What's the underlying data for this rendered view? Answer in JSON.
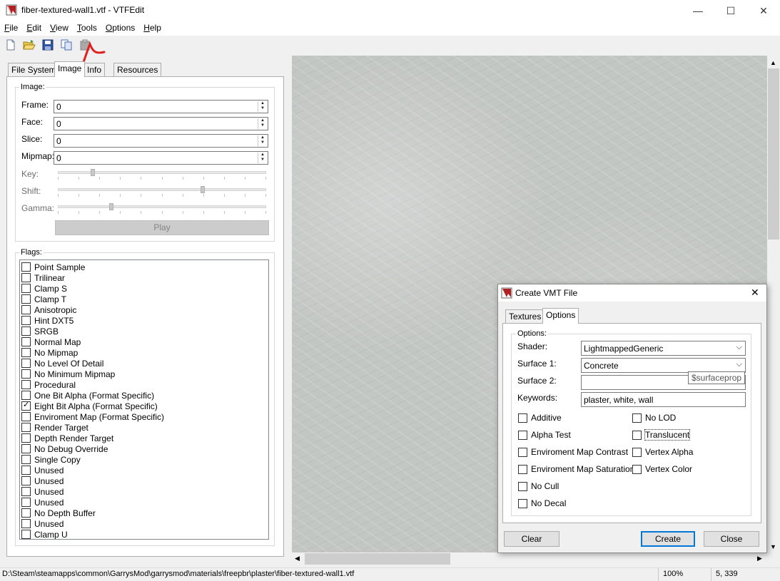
{
  "window": {
    "title": "fiber-textured-wall1.vtf - VTFEdit",
    "min_glyph": "—",
    "max_glyph": "☐",
    "close_glyph": "✕"
  },
  "menu": [
    {
      "label": "File",
      "accel": "F",
      "rest": "ile"
    },
    {
      "label": "Edit",
      "accel": "E",
      "rest": "dit"
    },
    {
      "label": "View",
      "accel": "V",
      "rest": "iew"
    },
    {
      "label": "Tools",
      "accel": "T",
      "rest": "ools"
    },
    {
      "label": "Options",
      "accel": "O",
      "rest": "ptions"
    },
    {
      "label": "Help",
      "accel": "H",
      "rest": "elp"
    }
  ],
  "toolbar": {
    "icons": [
      "new-icon",
      "open-icon",
      "save-icon",
      "copy-icon",
      "paste-icon"
    ]
  },
  "tabs": [
    "File System",
    "Image",
    "Info",
    "Resources"
  ],
  "active_tab": "Image",
  "image_group": {
    "label": "Image:",
    "frame_label": "Frame:",
    "frame_value": "0",
    "face_label": "Face:",
    "face_value": "0",
    "slice_label": "Slice:",
    "slice_value": "0",
    "mipmap_label": "Mipmap:",
    "mipmap_value": "0",
    "key_label": "Key:",
    "key_level": 0.16,
    "shift_label": "Shift:",
    "shift_level": 0.7,
    "gamma_label": "Gamma:",
    "gamma_level": 0.25,
    "play_label": "Play"
  },
  "flags_group": {
    "label": "Flags:",
    "items": [
      {
        "label": "Point Sample",
        "checked": false
      },
      {
        "label": "Trilinear",
        "checked": false
      },
      {
        "label": "Clamp S",
        "checked": false
      },
      {
        "label": "Clamp T",
        "checked": false
      },
      {
        "label": "Anisotropic",
        "checked": false
      },
      {
        "label": "Hint DXT5",
        "checked": false
      },
      {
        "label": "SRGB",
        "checked": false
      },
      {
        "label": "Normal Map",
        "checked": false
      },
      {
        "label": "No Mipmap",
        "checked": false
      },
      {
        "label": "No Level Of Detail",
        "checked": false
      },
      {
        "label": "No Minimum Mipmap",
        "checked": false
      },
      {
        "label": "Procedural",
        "checked": false
      },
      {
        "label": "One Bit Alpha (Format Specific)",
        "checked": false
      },
      {
        "label": "Eight Bit Alpha (Format Specific)",
        "checked": true
      },
      {
        "label": "Enviroment Map (Format Specific)",
        "checked": false
      },
      {
        "label": "Render Target",
        "checked": false
      },
      {
        "label": "Depth Render Target",
        "checked": false
      },
      {
        "label": "No Debug Override",
        "checked": false
      },
      {
        "label": "Single Copy",
        "checked": false
      },
      {
        "label": "Unused",
        "checked": false
      },
      {
        "label": "Unused",
        "checked": false
      },
      {
        "label": "Unused",
        "checked": false
      },
      {
        "label": "Unused",
        "checked": false
      },
      {
        "label": "No Depth Buffer",
        "checked": false
      },
      {
        "label": "Unused",
        "checked": false
      },
      {
        "label": "Clamp U",
        "checked": false
      }
    ]
  },
  "status": {
    "path": "D:\\Steam\\steamapps\\common\\GarrysMod\\garrysmod\\materials\\freepbr\\plaster\\fiber-textured-wall1.vtf",
    "zoom": "100%",
    "coords": "5, 339"
  },
  "dialog": {
    "title": "Create VMT File",
    "tabs": [
      "Textures",
      "Options"
    ],
    "active_tab": "Options",
    "options_label": "Options:",
    "shader_label": "Shader:",
    "shader_value": "LightmappedGeneric",
    "surface1_label": "Surface 1:",
    "surface1_value": "Concrete",
    "surface2_label": "Surface 2:",
    "surface2_value": "",
    "tooltip": "$surfaceprop",
    "keywords_label": "Keywords:",
    "keywords_value": "plaster, white, wall",
    "checks_left": [
      {
        "label": "Additive",
        "checked": false
      },
      {
        "label": "Alpha Test",
        "checked": false
      },
      {
        "label": "Enviroment Map Contrast",
        "checked": false
      },
      {
        "label": "Enviroment Map Saturation",
        "checked": false
      },
      {
        "label": "No Cull",
        "checked": false
      },
      {
        "label": "No Decal",
        "checked": false
      }
    ],
    "checks_right": [
      {
        "label": "No LOD",
        "checked": false
      },
      {
        "label": "Translucent",
        "checked": false
      },
      {
        "label": "Vertex Alpha",
        "checked": false
      },
      {
        "label": "Vertex Color",
        "checked": false
      }
    ],
    "clear_label": "Clear",
    "create_label": "Create",
    "close_label": "Close"
  },
  "colors": {
    "annotation": "#e0201c",
    "accent": "#0078d7"
  }
}
